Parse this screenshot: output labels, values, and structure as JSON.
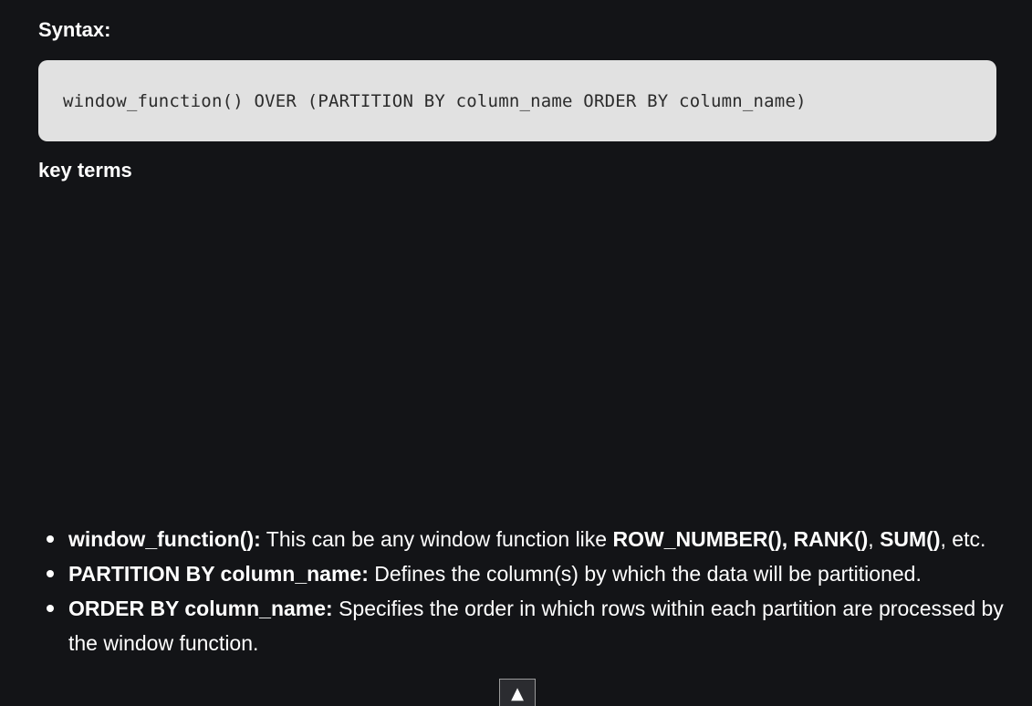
{
  "syntax": {
    "heading": "Syntax:",
    "code": "window_function() OVER (PARTITION BY column_name ORDER BY column_name)"
  },
  "key_terms": {
    "heading": "key terms",
    "items": [
      {
        "term": "window_function():",
        "text_1": " This can be any window function like ",
        "bold_1": "ROW_NUMBER(), RANK()",
        "text_2": ", ",
        "bold_2": "SUM()",
        "text_3": ", etc."
      },
      {
        "term": "PARTITION BY column_name:",
        "text_1": " Defines the column(s) by which the data will be partitioned."
      },
      {
        "term": "ORDER BY column_name:",
        "text_1": " Specifies the order in which rows within each partition are processed by the window function."
      }
    ]
  },
  "scroll_top": {
    "icon": "up-arrow-icon",
    "glyph": "▲"
  },
  "colors": {
    "background": "#131417",
    "code_background": "#e1e1e1",
    "text": "#ffffff"
  }
}
